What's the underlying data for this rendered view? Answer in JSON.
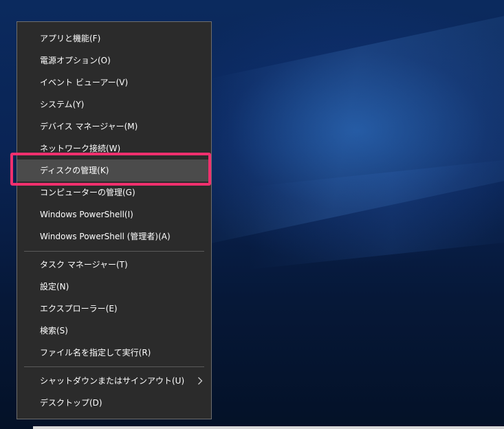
{
  "menu": {
    "items": [
      {
        "label": "アプリと機能(F)"
      },
      {
        "label": "電源オプション(O)"
      },
      {
        "label": "イベント ビューアー(V)"
      },
      {
        "label": "システム(Y)"
      },
      {
        "label": "デバイス マネージャー(M)"
      },
      {
        "label": "ネットワーク接続(W)"
      },
      {
        "label": "ディスクの管理(K)",
        "selected": true
      },
      {
        "label": "コンピューターの管理(G)"
      },
      {
        "label": "Windows PowerShell(I)"
      },
      {
        "label": "Windows PowerShell (管理者)(A)"
      },
      {
        "label": "タスク マネージャー(T)"
      },
      {
        "label": "設定(N)"
      },
      {
        "label": "エクスプローラー(E)"
      },
      {
        "label": "検索(S)"
      },
      {
        "label": "ファイル名を指定して実行(R)"
      },
      {
        "label": "シャットダウンまたはサインアウト(U)",
        "has_submenu": true
      },
      {
        "label": "デスクトップ(D)"
      }
    ]
  },
  "colors": {
    "menu_background": "#2b2b2b",
    "menu_selected": "#4b4b4b",
    "annotation_highlight": "#f0306e",
    "text": "#ffffff"
  },
  "icons": {
    "submenu_arrow": "chevron-right-icon"
  }
}
